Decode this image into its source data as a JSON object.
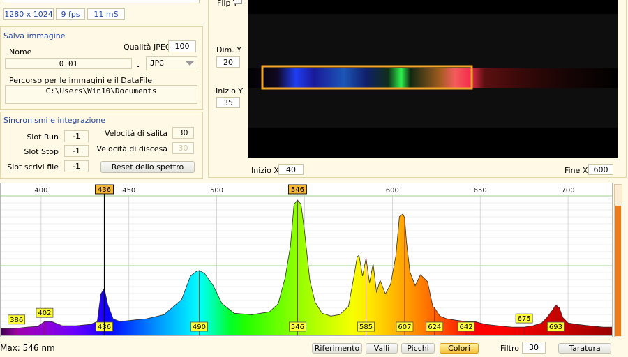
{
  "info_bar": {
    "resolution": "1280 x 1024",
    "fps": "9 fps",
    "exposure": "11 mS"
  },
  "save_image": {
    "title": "Salva immagine",
    "name_label": "Nome",
    "name_value": "0_01",
    "jpeg_quality_label": "Qualità JPEG",
    "jpeg_quality_value": "100",
    "dot": ".",
    "format_value": "JPG",
    "path_label": "Percorso per le immagini e il DataFile",
    "path_value": "C:\\Users\\Win10\\Documents"
  },
  "sync": {
    "title": "Sincronismi e integrazione",
    "slot_run_label": "Slot Run",
    "slot_run_value": "-1",
    "slot_stop_label": "Slot Stop",
    "slot_stop_value": "-1",
    "slot_write_label": "Slot scrivi file",
    "slot_write_value": "-1",
    "rise_speed_label": "Velocità di salita",
    "rise_speed_value": "30",
    "fall_speed_label": "Velocità di discesa",
    "fall_speed_value": "30",
    "reset_button": "Reset dello spettro"
  },
  "camera": {
    "flip_label": "Flip Y",
    "dim_y_label": "Dim. Y",
    "dim_y_value": "20",
    "start_y_label": "Inizio Y",
    "start_y_value": "35",
    "start_x_label": "Inizio X",
    "start_x_value": "40",
    "end_x_label": "Fine X",
    "end_x_value": "600"
  },
  "bottom_bar": {
    "max_label": "Max: 546 nm",
    "buttons": [
      "Riferimento",
      "Valli",
      "Picchi",
      "Colori"
    ],
    "active_button": "Colori",
    "filter_label": "Filtro",
    "filter_value": "30",
    "calibration_button": "Taratura"
  },
  "colors": {
    "accent": "#f2a52a",
    "label_blue": "#2446a8",
    "marker_yellow": "#ffff33"
  },
  "chart_data": {
    "type": "area",
    "xlabel": "",
    "ylabel": "",
    "x_ticks": [
      400,
      450,
      500,
      550,
      600,
      650,
      700
    ],
    "x_tick_labels": [
      "400",
      "450",
      "500",
      "",
      "600",
      "650",
      "700"
    ],
    "xlim": [
      377,
      725
    ],
    "ylim": [
      0,
      100
    ],
    "cursor_nm": 436,
    "cursor_labels": [
      "436",
      "546"
    ],
    "spectrum": {
      "x": [
        377,
        385,
        392,
        398,
        402,
        406,
        412,
        420,
        428,
        432,
        434,
        436,
        438,
        441,
        445,
        452,
        460,
        470,
        480,
        485,
        488,
        490,
        493,
        498,
        503,
        510,
        520,
        530,
        535,
        539,
        542,
        544,
        546,
        548,
        550,
        553,
        556,
        560,
        565,
        570,
        575,
        578,
        580,
        581,
        583,
        585,
        587,
        589,
        591,
        593,
        596,
        599,
        602,
        604,
        606,
        607,
        608,
        610,
        613,
        616,
        620,
        623,
        624,
        627,
        631,
        636,
        642,
        647,
        653,
        660,
        668,
        675,
        680,
        685,
        688,
        691,
        693,
        695,
        697,
        700,
        705,
        712,
        720,
        725
      ],
      "y": [
        5,
        5,
        6,
        6.5,
        10,
        10,
        7,
        7,
        8,
        10,
        30,
        34,
        22,
        12,
        10,
        11,
        12,
        15,
        26,
        43,
        46,
        47,
        45,
        36,
        23,
        16,
        15,
        17,
        23,
        42,
        65,
        95,
        98,
        95,
        75,
        40,
        24,
        16,
        14,
        15,
        21,
        42,
        57,
        58,
        43,
        56,
        38,
        52,
        31,
        40,
        30,
        37,
        58,
        86,
        88,
        85,
        68,
        46,
        36,
        44,
        39,
        21,
        20,
        14,
        12,
        11,
        10,
        10,
        8,
        7,
        6,
        6,
        7,
        9,
        13,
        18,
        22,
        20,
        13,
        9,
        8,
        7,
        6,
        6
      ]
    },
    "peaks": [
      {
        "nm": 386,
        "label": "386",
        "row": "upper"
      },
      {
        "nm": 402,
        "label": "402",
        "row": "upper"
      },
      {
        "nm": 436,
        "label": "436",
        "row": "lower"
      },
      {
        "nm": 490,
        "label": "490",
        "row": "lower"
      },
      {
        "nm": 546,
        "label": "546",
        "row": "lower"
      },
      {
        "nm": 585,
        "label": "585",
        "row": "lower"
      },
      {
        "nm": 607,
        "label": "607",
        "row": "lower"
      },
      {
        "nm": 624,
        "label": "624",
        "row": "lower"
      },
      {
        "nm": 642,
        "label": "642",
        "row": "lower"
      },
      {
        "nm": 675,
        "label": "675",
        "row": "upper"
      },
      {
        "nm": 693,
        "label": "693",
        "row": "lower"
      }
    ],
    "level_bar_fraction": 0.86
  }
}
